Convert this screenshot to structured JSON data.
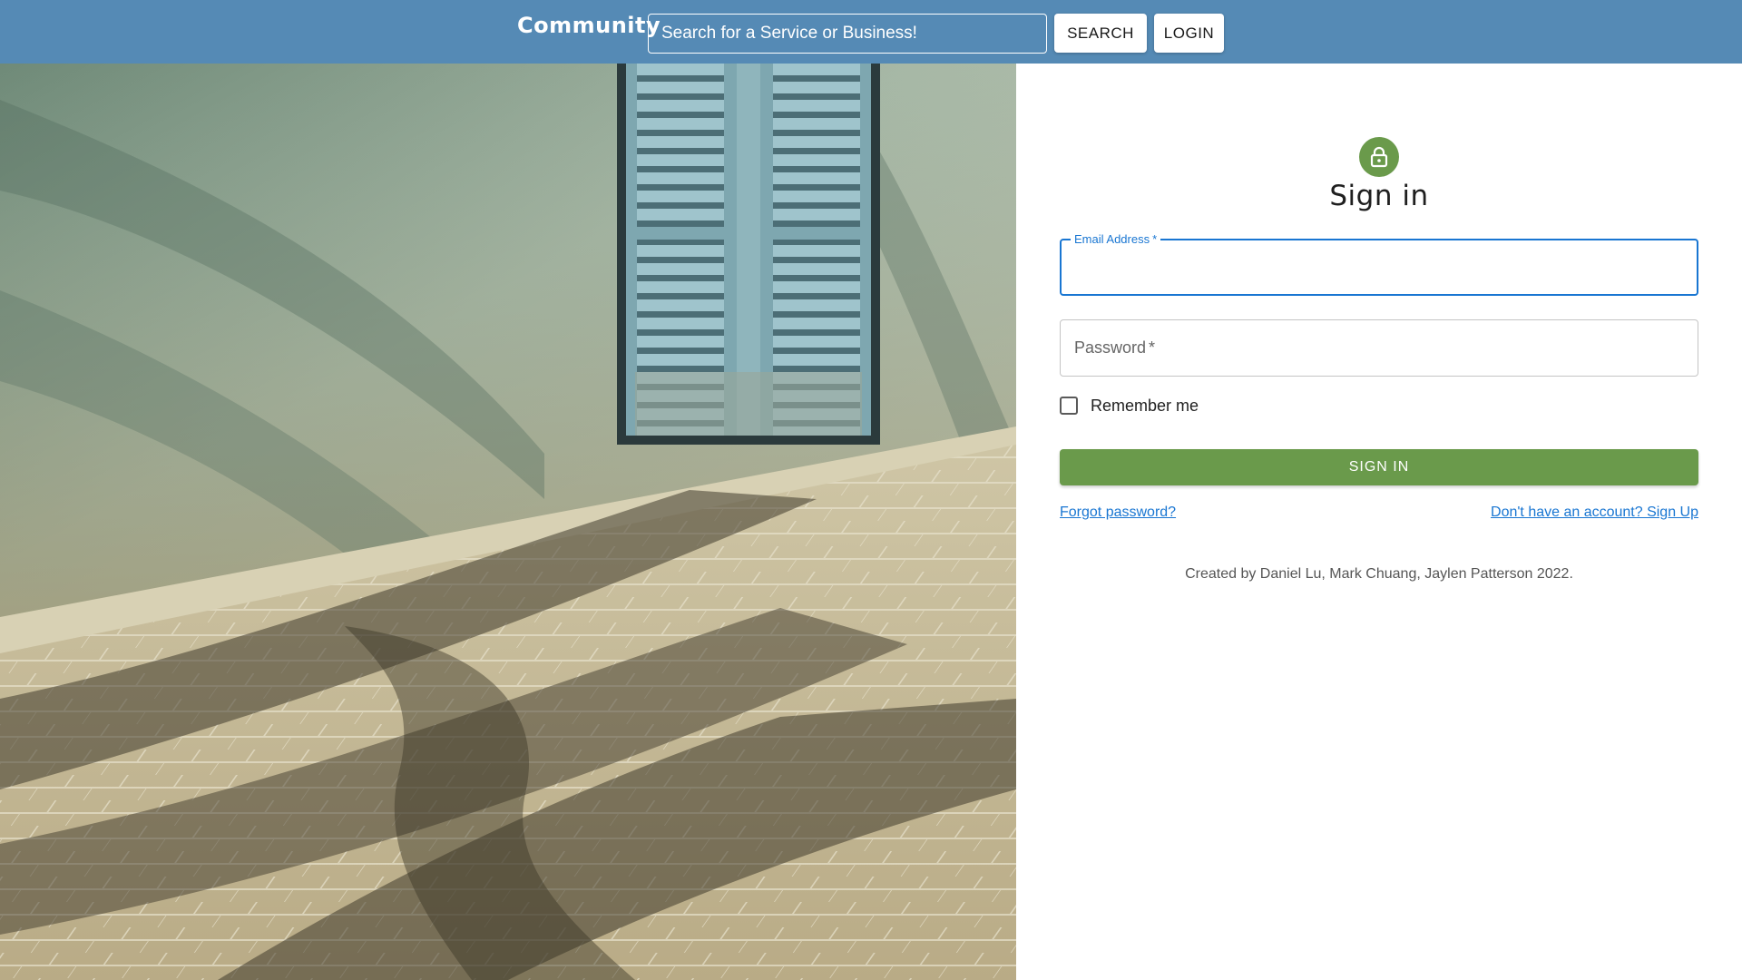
{
  "colors": {
    "navbar": "#558ab5",
    "accent_green": "#6a9a4b",
    "focus_blue": "#1976d2",
    "link_blue": "#1976d2"
  },
  "navbar": {
    "brand": "Community",
    "search_placeholder": "Search for a Service or Business!",
    "search_button": "SEARCH",
    "login_button": "LOGIN"
  },
  "hero": {
    "icon": "shuttered-window-photo"
  },
  "signin": {
    "icon": "lock-icon",
    "title": "Sign in",
    "email_label": "Email Address",
    "email_value": "",
    "password_label": "Password",
    "password_value": "",
    "required_mark": "*",
    "remember_label": "Remember me",
    "remember_checked": false,
    "submit_button": "SIGN IN",
    "forgot_link": "Forgot password?",
    "signup_link": "Don't have an account? Sign Up",
    "credits": "Created by Daniel Lu, Mark Chuang, Jaylen Patterson 2022."
  }
}
